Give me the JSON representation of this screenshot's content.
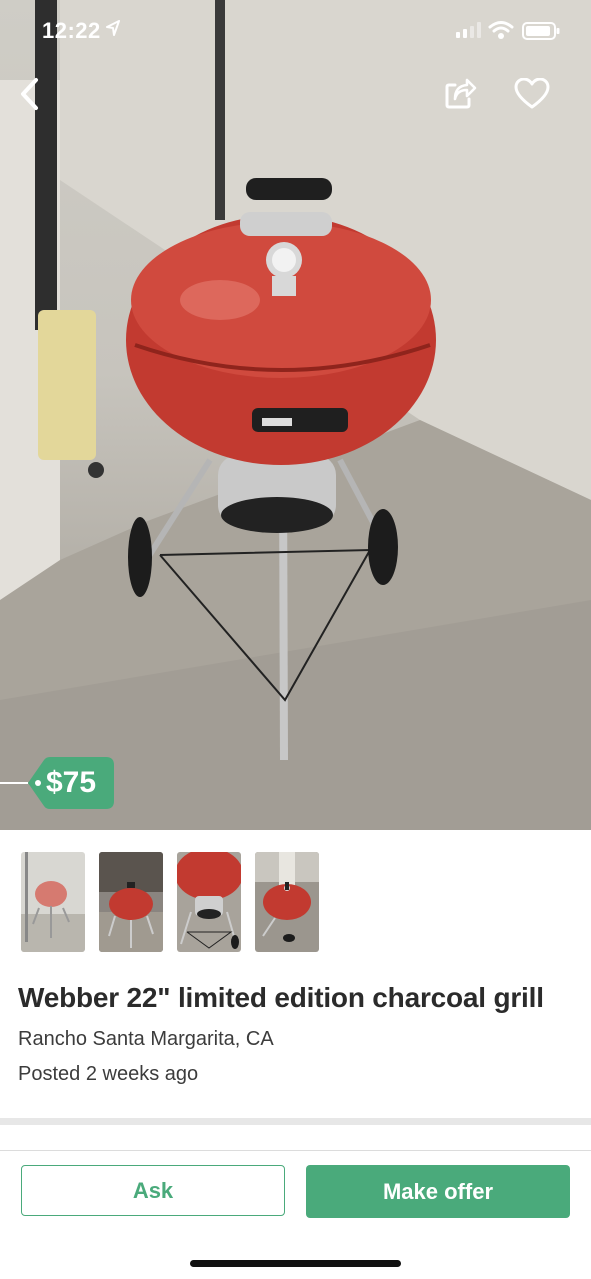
{
  "status_bar": {
    "time": "12:22",
    "icons": [
      "location-arrow-icon",
      "signal-icon",
      "wifi-icon",
      "battery-icon"
    ]
  },
  "nav": {
    "icons": [
      "chevron-left-icon",
      "share-icon",
      "heart-icon"
    ]
  },
  "listing": {
    "price": "$75",
    "title": "Webber 22\" limited edition charcoal grill",
    "location": "Rancho Santa Margarita, CA",
    "posted": "Posted 2 weeks ago",
    "photo_count": 4
  },
  "actions": {
    "ask_label": "Ask",
    "offer_label": "Make offer"
  },
  "colors": {
    "accent": "#4aaa7b",
    "grill_red": "#c23a30"
  }
}
